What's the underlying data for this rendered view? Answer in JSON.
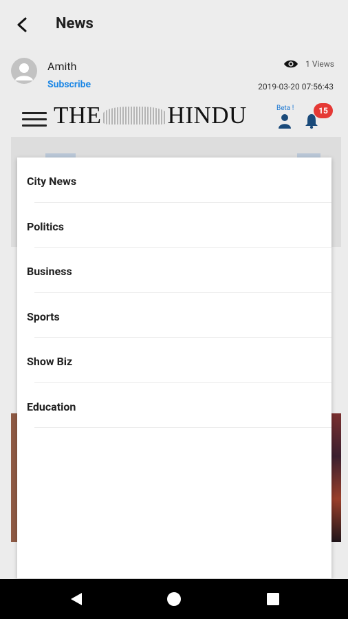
{
  "app_bar": {
    "title": "News"
  },
  "post": {
    "author": "Amith",
    "subscribe_label": "Subscribe",
    "views": "1 Views",
    "timestamp": "2019-03-20 07:56:43"
  },
  "masthead": {
    "logo_left": "THE",
    "logo_right": "HINDU",
    "beta_label": "Beta !",
    "notification_count": "15"
  },
  "menu": {
    "items": [
      {
        "label": "City News"
      },
      {
        "label": "Politics"
      },
      {
        "label": "Business"
      },
      {
        "label": "Sports"
      },
      {
        "label": "Show Biz"
      },
      {
        "label": "Education"
      }
    ]
  },
  "colors": {
    "accent": "#1e88e5",
    "badge": "#e53935",
    "navbar": "#000000"
  },
  "icons": [
    "back-arrow-icon",
    "avatar-icon",
    "eye-icon",
    "hamburger-icon",
    "user-icon",
    "bell-icon",
    "nav-back-icon",
    "nav-home-icon",
    "nav-recents-icon"
  ]
}
